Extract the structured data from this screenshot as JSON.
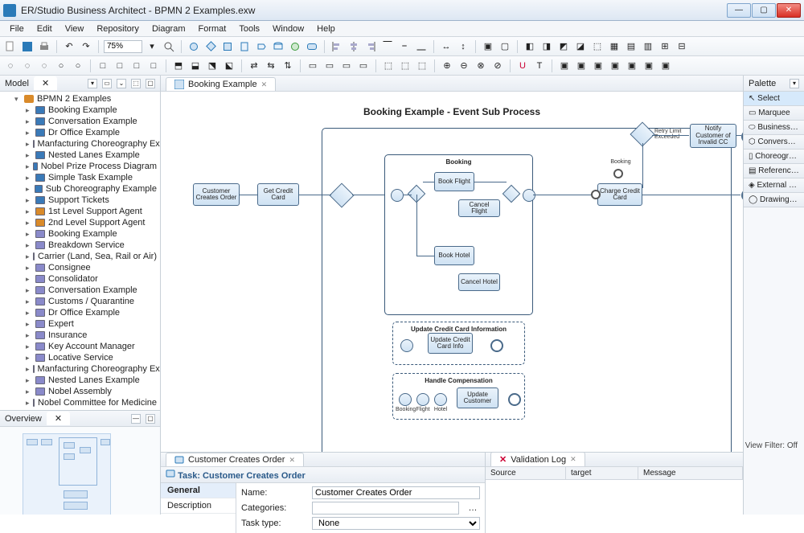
{
  "app": {
    "title": "ER/Studio Business Architect - BPMN 2 Examples.exw"
  },
  "menu": [
    "File",
    "Edit",
    "View",
    "Repository",
    "Diagram",
    "Format",
    "Tools",
    "Window",
    "Help"
  ],
  "zoom": "75%",
  "model_pane": {
    "title": "Model",
    "root": "BPMN 2 Examples",
    "items": [
      "Booking Example",
      "Conversation Example",
      "Dr Office Example",
      "Manfacturing Choreography Example",
      "Nested Lanes Example",
      "Nobel Prize Process Diagram",
      "Simple Task Example",
      "Sub Choreography Example",
      "Support Tickets",
      "1st Level Support Agent",
      "2nd Level Support Agent",
      "Booking Example",
      "Breakdown Service",
      "Carrier (Land, Sea, Rail or Air)",
      "Consignee",
      "Consolidator",
      "Conversation Example",
      "Customs / Quarantine",
      "Dr Office Example",
      "Expert",
      "Insurance",
      "Key Account Manager",
      "Locative Service",
      "Manfacturing Choreography Example",
      "Nested Lanes Example",
      "Nobel Assembly",
      "Nobel Committee for Medicine"
    ]
  },
  "overview_pane": {
    "title": "Overview"
  },
  "editor": {
    "tab": "Booking Example",
    "heading": "Booking Example - Event Sub Process",
    "tasks": {
      "t1": "Customer Creates Order",
      "t2": "Get Credit Card",
      "t3": "Book Flight",
      "t4": "Cancel Flight",
      "t5": "Book Hotel",
      "t6": "Cancel Hotel",
      "t7": "Charge Credit Card",
      "t8": "Notify Customer of Invalid CC",
      "t9": "Update Credit Card Info",
      "t10": "Update Customer"
    },
    "sub": {
      "s1": "Booking",
      "s2": "Update Credit Card Information",
      "s3": "Handle Compensation"
    },
    "labels": {
      "retry": "Retry Limit Exceeded",
      "booking": "Booking",
      "hc_booking": "Booking",
      "hc_flight": "Flight",
      "hc_hotel": "Hotel"
    }
  },
  "props": {
    "tab": "Customer Creates Order",
    "title": "Task: Customer Creates Order",
    "side": [
      "General",
      "Description"
    ],
    "name_label": "Name:",
    "name_value": "Customer Creates Order",
    "cat_label": "Categories:",
    "cat_value": "",
    "type_label": "Task type:",
    "type_value": "None"
  },
  "validation": {
    "tab": "Validation Log",
    "cols": [
      "Source",
      "target",
      "Message"
    ]
  },
  "palette": {
    "title": "Palette",
    "items": [
      "Select",
      "Marquee",
      "Business Process O...",
      "Conversation Diagr...",
      "Choreography  Dia...",
      "Reference Objects",
      "External Data Obje...",
      "Drawing Shapes"
    ]
  },
  "status": "Model View Filter: Off"
}
